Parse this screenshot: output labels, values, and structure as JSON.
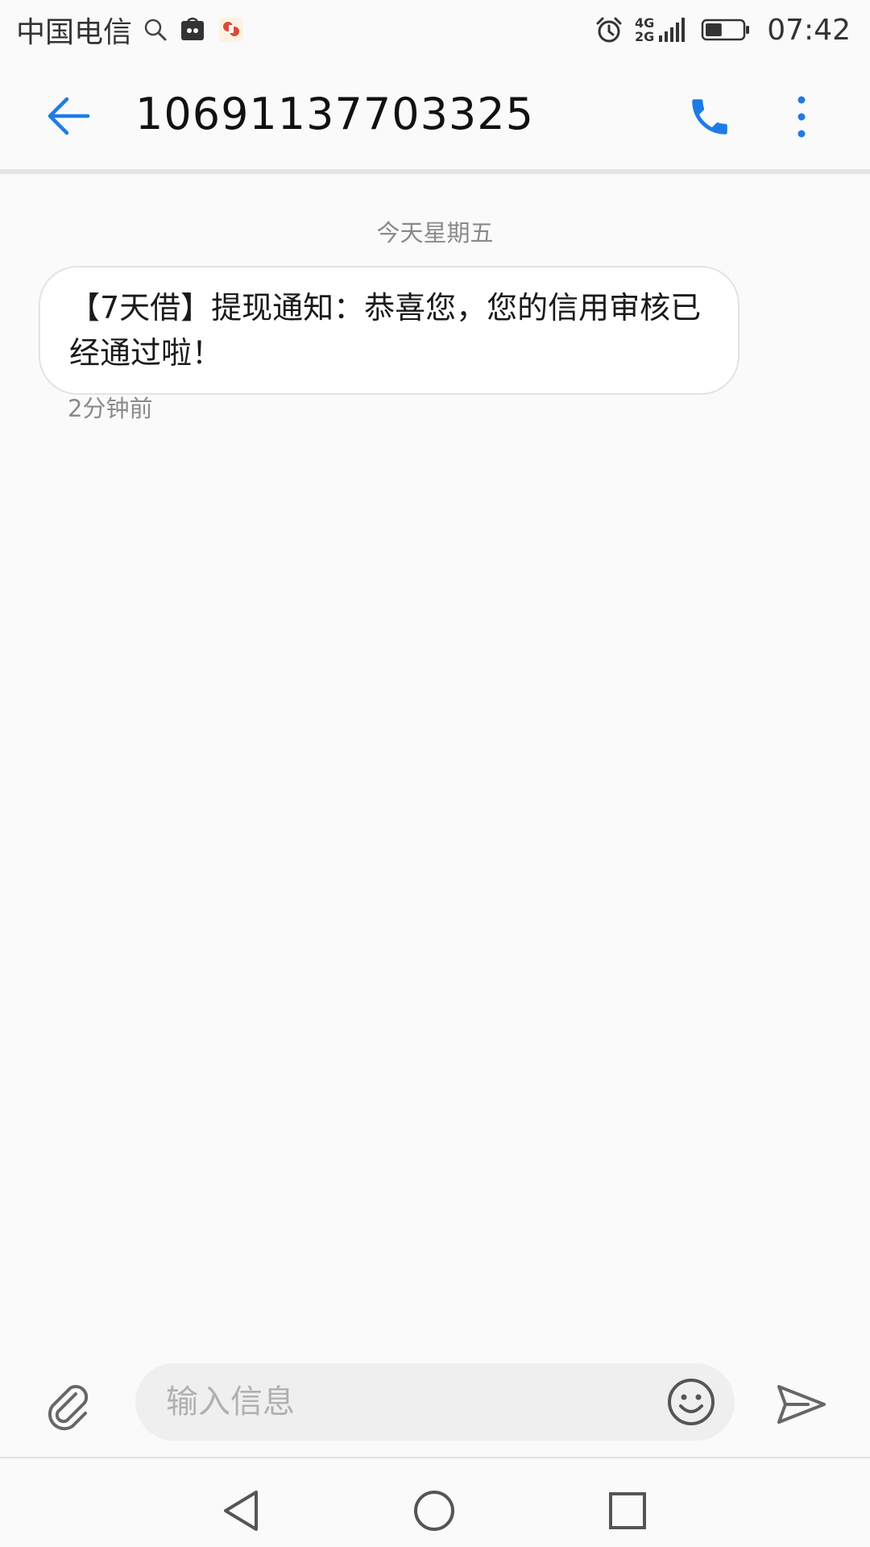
{
  "status_bar": {
    "carrier": "中国电信",
    "time": "07:42",
    "network_top": "4G",
    "network_bottom": "2G",
    "icons": [
      "search-icon",
      "huawei-shop-icon",
      "app-notification-icon",
      "alarm-icon",
      "signal-icon",
      "battery-icon"
    ],
    "battery_level": 0.45
  },
  "header": {
    "title": "10691137703325",
    "icons": [
      "back-arrow-icon",
      "phone-icon",
      "more-vertical-icon"
    ]
  },
  "conversation": {
    "date_label": "今天星期五",
    "messages": [
      {
        "text": "【7天借】提现通知：恭喜您，您的信用审核已经通过啦！",
        "time": "2分钟前"
      }
    ]
  },
  "composer": {
    "placeholder": "输入信息",
    "icons": [
      "paperclip-icon",
      "emoji-icon",
      "send-icon"
    ]
  },
  "nav_bar": {
    "icons": [
      "nav-back-icon",
      "nav-home-icon",
      "nav-recents-icon"
    ]
  },
  "colors": {
    "accent": "#1e7be6",
    "background": "#fafafa",
    "bubble": "#ffffff",
    "muted_text": "#8a8a8a"
  }
}
